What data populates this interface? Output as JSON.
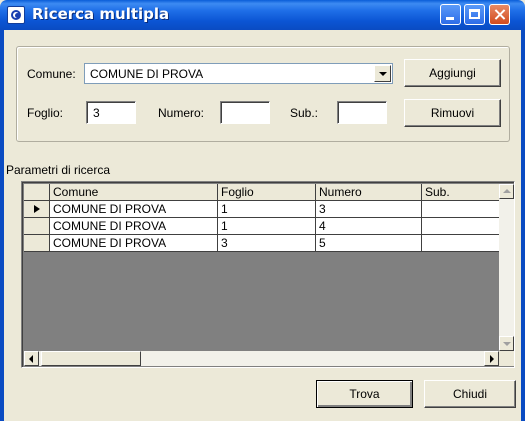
{
  "window": {
    "title": "Ricerca multipla",
    "icon": "app-logo-icon"
  },
  "form": {
    "comune_label": "Comune:",
    "comune_value": "COMUNE DI PROVA",
    "foglio_label": "Foglio:",
    "foglio_value": "3",
    "numero_label": "Numero:",
    "numero_value": "",
    "sub_label": "Sub.:",
    "sub_value": ""
  },
  "buttons": {
    "aggiungi": "Aggiungi",
    "rimuovi": "Rimuovi",
    "trova": "Trova",
    "chiudi": "Chiudi"
  },
  "grid": {
    "caption": "Parametri di ricerca",
    "columns": [
      "Comune",
      "Foglio",
      "Numero",
      "Sub."
    ],
    "rows": [
      [
        "COMUNE DI PROVA",
        "1",
        "3",
        ""
      ],
      [
        "COMUNE DI PROVA",
        "1",
        "4",
        ""
      ],
      [
        "COMUNE DI PROVA",
        "3",
        "5",
        ""
      ]
    ],
    "current_row": 0
  },
  "colors": {
    "titlebar": "#0A5DD8",
    "face": "#ECE9D8"
  }
}
